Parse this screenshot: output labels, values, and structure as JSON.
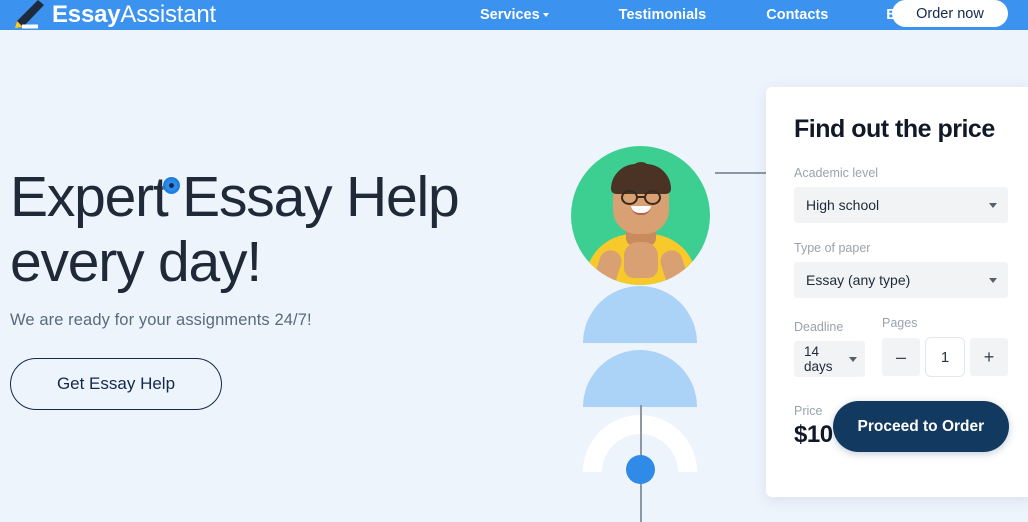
{
  "brand": {
    "logo_icon": "pencil-icon",
    "name_bold": "Essay",
    "name_light": "Assistant"
  },
  "nav": {
    "links": [
      {
        "label": "Services",
        "has_dropdown": true
      },
      {
        "label": "Testimonials",
        "has_dropdown": false
      },
      {
        "label": "Contacts",
        "has_dropdown": false
      },
      {
        "label": "Blog",
        "has_dropdown": false
      }
    ],
    "order_now_label": "Order now",
    "background_color": "#3b93ef"
  },
  "hero": {
    "title": "Expert Essay Help\never y day!",
    "title_line1": "Expert Essay Help",
    "title_line2": "every day!",
    "subtitle": "We are ready for your assignments 24/7!",
    "cta_label": "Get Essay Help"
  },
  "illustration": {
    "avatar_alt": "smiling student in yellow shirt",
    "avatar_background_color": "#3ccf91",
    "shirt_color": "#f7c92b",
    "dome_color": "#abd2f7",
    "arc_color": "#ffffff",
    "dot_color": "#2f8ae8",
    "connector_line_color": "#8c98a4"
  },
  "price_card": {
    "title": "Find out the price",
    "academic_level": {
      "label": "Academic level",
      "value": "High school"
    },
    "type_of_paper": {
      "label": "Type of paper",
      "value": "Essay (any type)"
    },
    "deadline": {
      "label": "Deadline",
      "value": "14 days"
    },
    "pages": {
      "label": "Pages",
      "value": "1",
      "decrement_label": "–",
      "increment_label": "+"
    },
    "price": {
      "label": "Price",
      "value": "$10"
    },
    "proceed_label": "Proceed to Order",
    "proceed_color": "#12395f"
  },
  "page": {
    "background_color": "#eef4fc"
  }
}
